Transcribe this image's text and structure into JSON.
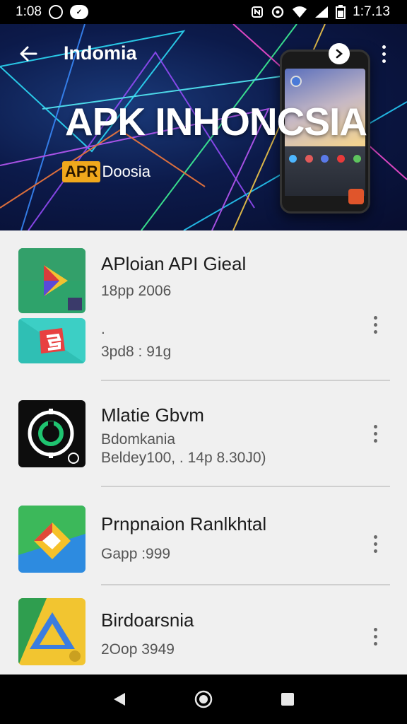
{
  "status_bar": {
    "time": "1:08",
    "right_time": "1:7.13",
    "icons_left": [
      "alarm-circle-icon",
      "messenger-icon"
    ],
    "icons_right": [
      "nfc-icon",
      "sync-icon",
      "wifi-icon",
      "signal-icon",
      "battery-icon"
    ]
  },
  "header": {
    "title": "Indomia",
    "hero_title": "APK INHONCSIA",
    "hero_badge": "APR",
    "hero_sub": " Doosia",
    "icons": [
      "back-arrow-icon",
      "share-icon",
      "more-vertical-icon"
    ]
  },
  "apps": [
    {
      "title": "APloian API Gieal",
      "meta_line1": "18pp 2006",
      "meta_line2": ".",
      "meta_line3": "3pd8 : 91g",
      "icon": "drive-style-app-icon"
    },
    {
      "title": "Mlatie Gbvm",
      "meta_line1": "Bdomkania",
      "meta_line2": "Beldey100, . 14p 8.30J0)",
      "icon": "clock-app-icon"
    },
    {
      "title": "Prnpnaion Ranlkhtal",
      "meta_line1": "Gapp :999",
      "icon": "maps-style-app-icon"
    },
    {
      "title": "Birdoarsnia",
      "meta_line1": "2Oop 3949",
      "icon": "drive-triangle-app-icon"
    }
  ],
  "nav_bar": {
    "icons": [
      "back-triangle-icon",
      "home-circle-icon",
      "recents-square-icon"
    ]
  },
  "colors": {
    "header_bg": "#0c1a4a",
    "badge": "#f0a81c",
    "list_bg": "#f0f0f0"
  }
}
